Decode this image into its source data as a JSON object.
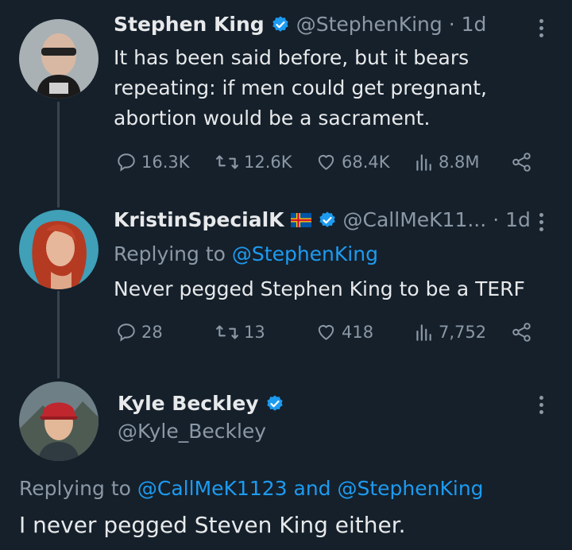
{
  "tweets": [
    {
      "name": "Stephen King",
      "handle": "@StephenKing",
      "time": "· 1d",
      "text_lines": [
        "It has been said before, but it bears",
        "repeating: if men could get pregnant,",
        "abortion would be a sacrament."
      ],
      "metrics": {
        "replies": "16.3K",
        "retweets": "12.6K",
        "likes": "68.4K",
        "views": "8.8M"
      }
    },
    {
      "name": "KristinSpecialK",
      "handle": "@CallMeK11...",
      "time": "· 1d",
      "replying_prefix": "Replying to",
      "replying_to": "@StephenKing",
      "text": "Never pegged Stephen King to be a TERF",
      "metrics": {
        "replies": "28",
        "retweets": "13",
        "likes": "418",
        "views": "7,752"
      }
    },
    {
      "name": "Kyle Beckley",
      "handle": "@Kyle_Beckley",
      "replying_prefix": "Replying to",
      "replying_to_1": "@CallMeK1123",
      "replying_and": "and",
      "replying_to_2": "@StephenKing",
      "text": "I never pegged Steven King either."
    }
  ],
  "colors": {
    "background": "#15202b",
    "text": "#e7e9ea",
    "secondary": "#8b98a5",
    "accent": "#1d9bf0",
    "thread_line": "#38444d"
  }
}
